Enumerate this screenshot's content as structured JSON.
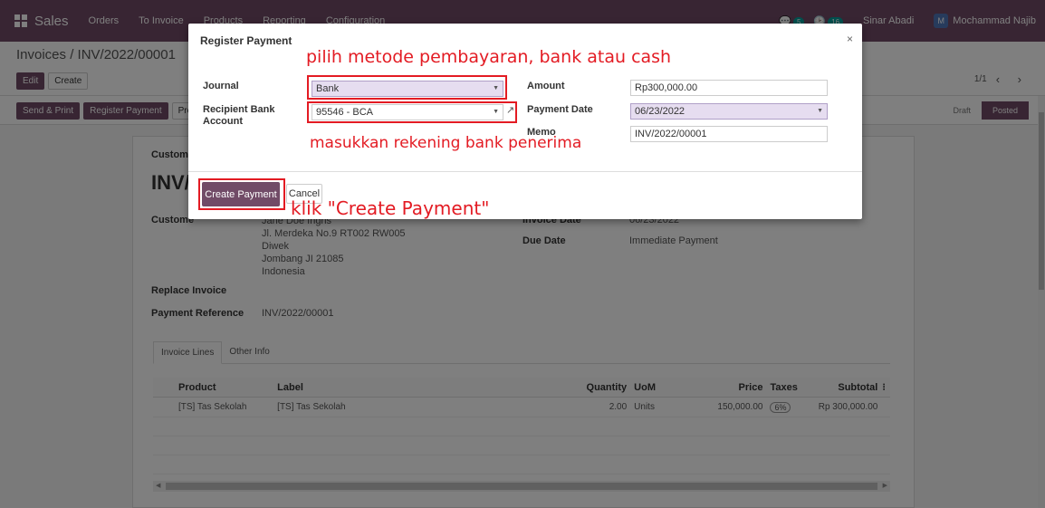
{
  "navbar": {
    "app_name": "Sales",
    "menu": [
      "Orders",
      "To Invoice",
      "Products",
      "Reporting",
      "Configuration"
    ],
    "messages_count": "5",
    "activities_count": "16",
    "company": "Sinar Abadi",
    "user_initial": "M",
    "user_name": "Mochammad Najib"
  },
  "control_panel": {
    "breadcrumb": "Invoices / INV/2022/00001",
    "edit_label": "Edit",
    "create_label": "Create",
    "pager": "1/1",
    "pager_arrows": "‹ ›"
  },
  "statusbar": {
    "send_print_label": "Send & Print",
    "register_payment_label": "Register Payment",
    "preview_label": "Pre",
    "states": [
      "Draft",
      "Posted"
    ]
  },
  "invoice": {
    "customer_label_top": "Custome",
    "title_fragment": "INV/2",
    "customer_label": "Custome",
    "address_partial": "Jane Doe Ingris",
    "address": [
      "Jl. Merdeka No.9 RT002 RW005",
      "Diwek",
      "Jombang JI 21085",
      "Indonesia"
    ],
    "invoice_date_label": "Invoice Date",
    "invoice_date_value": "06/23/2022",
    "due_date_label": "Due Date",
    "due_date_value": "Immediate Payment",
    "replace_invoice_label": "Replace Invoice",
    "payment_reference_label": "Payment Reference",
    "payment_reference_value": "INV/2022/00001",
    "tabs": [
      "Invoice Lines",
      "Other Info"
    ],
    "columns": {
      "product": "Product",
      "label": "Label",
      "quantity": "Quantity",
      "uom": "UoM",
      "price": "Price",
      "taxes": "Taxes",
      "subtotal": "Subtotal",
      "options": "⁝"
    },
    "lines": [
      {
        "product": "[TS] Tas Sekolah",
        "label": "[TS] Tas Sekolah",
        "quantity": "2.00",
        "uom": "Units",
        "price": "150,000.00",
        "taxes": "6%",
        "subtotal": "Rp 300,000.00"
      }
    ]
  },
  "modal": {
    "title": "Register Payment",
    "close": "×",
    "journal_label": "Journal",
    "journal_value": "Bank",
    "recipient_label": "Recipient Bank Account",
    "recipient_value": "95546 - BCA",
    "amount_label": "Amount",
    "amount_value": "Rp300,000.00",
    "payment_date_label": "Payment Date",
    "payment_date_value": "06/23/2022",
    "memo_label": "Memo",
    "memo_value": "INV/2022/00001",
    "create_payment_label": "Create Payment",
    "cancel_label": "Cancel"
  },
  "annotations": {
    "journal_hint": "pilih metode pembayaran, bank atau cash",
    "recipient_hint": "masukkan rekening bank penerima",
    "create_hint": "klik \"Create Payment\""
  },
  "colors": {
    "brand": "#714b67",
    "annotation": "#e31b23",
    "select_fill": "#e6ddf0"
  }
}
